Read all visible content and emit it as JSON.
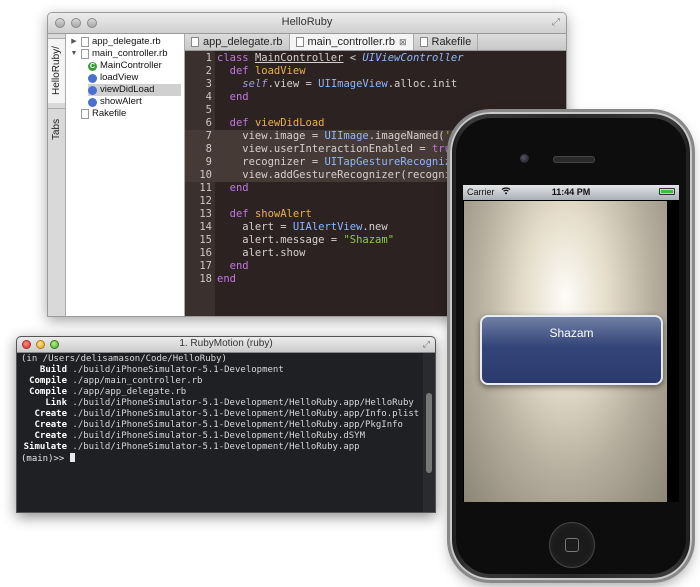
{
  "editor": {
    "title": "HelloRuby",
    "side_tabs": [
      "HelloRuby/",
      "Tabs"
    ],
    "tree": [
      {
        "label": "app_delegate.rb",
        "kind": "file",
        "expander": "▶"
      },
      {
        "label": "main_controller.rb",
        "kind": "file",
        "expander": "▼"
      },
      {
        "label": "MainController",
        "kind": "class",
        "badge": "C"
      },
      {
        "label": "loadView",
        "kind": "method"
      },
      {
        "label": "viewDidLoad",
        "kind": "method",
        "selected": true
      },
      {
        "label": "showAlert",
        "kind": "method"
      },
      {
        "label": "Rakefile",
        "kind": "file"
      }
    ],
    "tabs": [
      {
        "label": "app_delegate.rb",
        "active": false
      },
      {
        "label": "main_controller.rb",
        "active": true,
        "close": "⊠"
      },
      {
        "label": "Rakefile",
        "active": false
      }
    ],
    "code_lines": [
      {
        "num": "1",
        "text": "class MainController < UIViewController"
      },
      {
        "num": "2",
        "text": "  def loadView"
      },
      {
        "num": "3",
        "text": "    self.view = UIImageView.alloc.init"
      },
      {
        "num": "4",
        "text": "  end"
      },
      {
        "num": "5",
        "text": ""
      },
      {
        "num": "6",
        "text": "  def viewDidLoad"
      },
      {
        "num": "7",
        "text": "    view.image = UIImage.imageNamed('back"
      },
      {
        "num": "8",
        "text": "    view.userInteractionEnabled = true"
      },
      {
        "num": "9",
        "text": "    recognizer = UITapGestureRecognizer"
      },
      {
        "num": "10",
        "text": "    view.addGestureRecognizer(recognize"
      },
      {
        "num": "11",
        "text": "  end"
      },
      {
        "num": "12",
        "text": ""
      },
      {
        "num": "13",
        "text": "  def showAlert"
      },
      {
        "num": "14",
        "text": "    alert = UIAlertView.new"
      },
      {
        "num": "15",
        "text": "    alert.message = \"Shazam\""
      },
      {
        "num": "16",
        "text": "    alert.show"
      },
      {
        "num": "17",
        "text": "  end"
      },
      {
        "num": "18",
        "text": "end"
      }
    ]
  },
  "terminal": {
    "title": "1. RubyMotion (ruby)",
    "lines": [
      {
        "verb": "",
        "text": "(in /Users/delisamason/Code/HelloRuby)"
      },
      {
        "verb": "Build",
        "text": "./build/iPhoneSimulator-5.1-Development"
      },
      {
        "verb": "Compile",
        "text": "./app/main_controller.rb"
      },
      {
        "verb": "Compile",
        "text": "./app/app_delegate.rb"
      },
      {
        "verb": "Link",
        "text": "./build/iPhoneSimulator-5.1-Development/HelloRuby.app/HelloRuby"
      },
      {
        "verb": "Create",
        "text": "./build/iPhoneSimulator-5.1-Development/HelloRuby.app/Info.plist"
      },
      {
        "verb": "Create",
        "text": "./build/iPhoneSimulator-5.1-Development/HelloRuby.app/PkgInfo"
      },
      {
        "verb": "Create",
        "text": "./build/iPhoneSimulator-5.1-Development/HelloRuby.dSYM"
      },
      {
        "verb": "Simulate",
        "text": "./build/iPhoneSimulator-5.1-Development/HelloRuby.app"
      }
    ],
    "prompt": "(main)>> "
  },
  "phone": {
    "carrier": "Carrier",
    "wifi_icon": "wifi-icon",
    "time": "11:44 PM",
    "alert_message": "Shazam"
  }
}
